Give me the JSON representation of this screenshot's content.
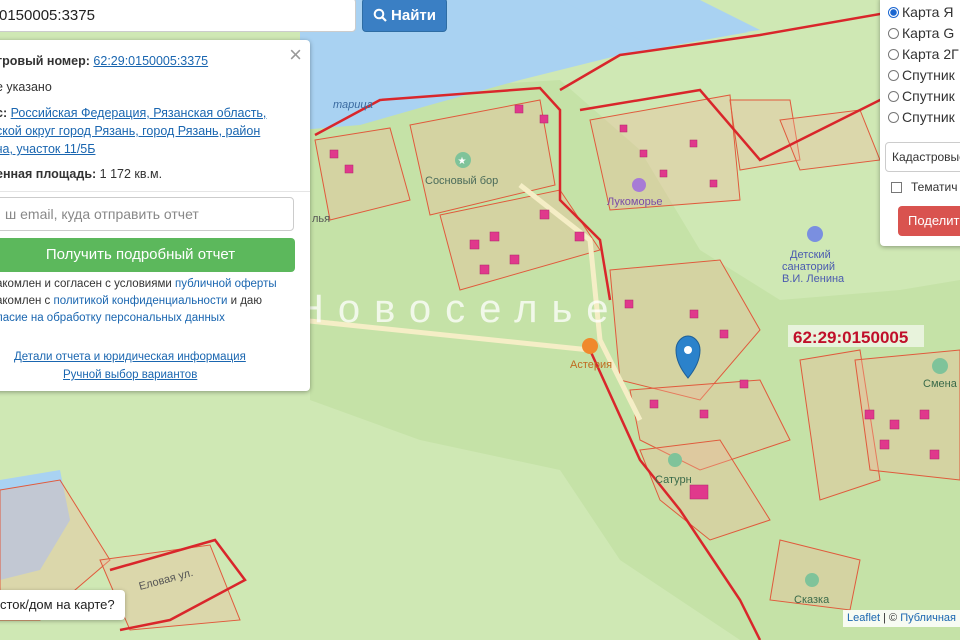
{
  "search": {
    "value": "0150005:3375",
    "button_label": "Найти"
  },
  "info": {
    "cadastral_label": "тровый номер:",
    "cadastral_value": "62:29:0150005:3375",
    "status": "е указано",
    "address_label": "с:",
    "address_line1": "Российская Федерация, Рязанская область,",
    "address_line2": "ской округ город Рязань, город Рязань, район",
    "address_line3": "ча, участок 11/5Б",
    "area_label": "енная площадь:",
    "area_value": "1 172 кв.м.",
    "email_placeholder": "ш email, куда отправить отчет",
    "report_button": "Получить подробный отчет",
    "consent1_pre": "акомлен и согласен с условиями",
    "consent1_link": "публичной оферты",
    "consent2_pre": "акомлен с",
    "consent2_link": "политикой конфиденциальности",
    "consent2_post": "и даю",
    "consent3_link": "ласие на обработку персональных данных",
    "details_link": "Детали отчета и юридическая информация",
    "manual_link": "Ручной выбор вариантов"
  },
  "layers": {
    "options": [
      {
        "label": "Карта Я",
        "selected": true
      },
      {
        "label": "Карта G",
        "selected": false
      },
      {
        "label": "Карта 2Г",
        "selected": false
      },
      {
        "label": "Спутник",
        "selected": false
      },
      {
        "label": "Спутник",
        "selected": false
      },
      {
        "label": "Спутник",
        "selected": false
      }
    ],
    "overlay_select": "Кадастровые",
    "thematic_label": "Тематич",
    "share_button": "Поделит"
  },
  "bottom_question": "сток/дом на карте?",
  "attribution": {
    "leaflet": "Leaflet",
    "separator": "|",
    "copy": "©",
    "public": "Публичная"
  },
  "map_labels": {
    "river": "тарица",
    "sosnovy_bor": "Сосновый бор",
    "lukomorye": "Лукоморье",
    "sanatorium_1": "Детский",
    "sanatorium_2": "санаторий",
    "sanatorium_3": "В.И. Ленина",
    "quarter": "62:29:0150005",
    "novoselye": "Новоселье",
    "asteria": "Астерия",
    "saturn": "Сатурн",
    "smena": "Смена",
    "skazka": "Сказка",
    "elovaya": "Еловая ул.",
    "fragment_left": "лья"
  },
  "colors": {
    "land": "#cfe8b4",
    "water": "#a9d2f2",
    "parcel_stroke": "#e05a3c",
    "quarter_stroke": "#d9262b",
    "building": "#e0398c",
    "accent": "#3a7fc4",
    "report_green": "#5cb85c",
    "share_red": "#d9534f"
  }
}
